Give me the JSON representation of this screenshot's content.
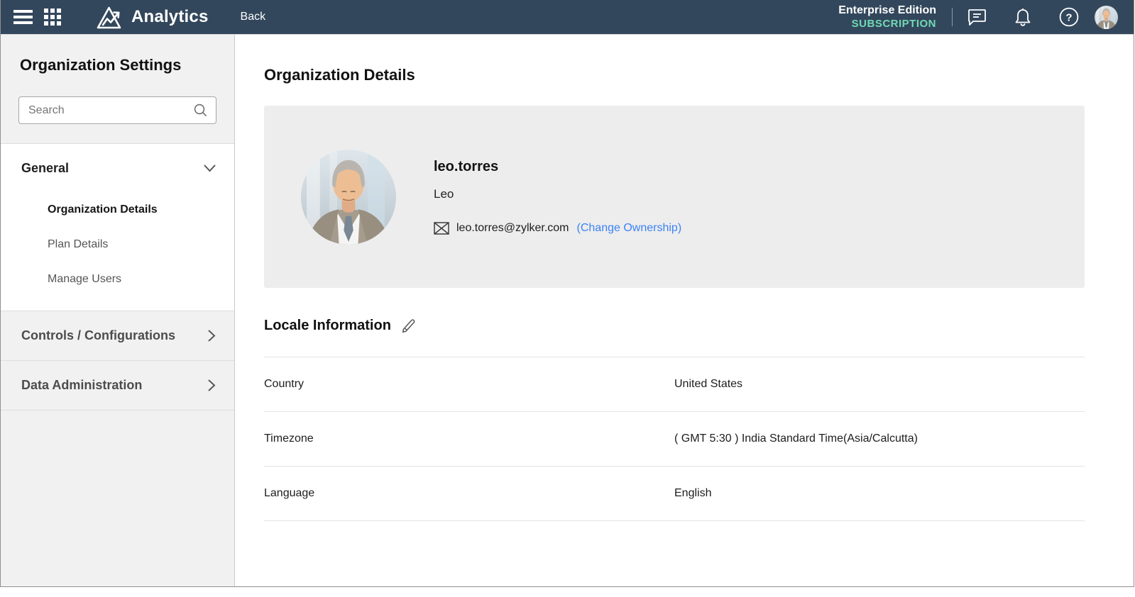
{
  "topbar": {
    "product_name": "Analytics",
    "back_label": "Back",
    "edition_name": "Enterprise Edition",
    "subscription_label": "SUBSCRIPTION",
    "help_glyph": "?"
  },
  "sidebar": {
    "title": "Organization Settings",
    "search": {
      "placeholder": "Search"
    },
    "general_group": {
      "label": "General",
      "items": [
        {
          "label": "Organization Details",
          "active": true
        },
        {
          "label": "Plan Details",
          "active": false
        },
        {
          "label": "Manage Users",
          "active": false
        }
      ]
    },
    "collapsed_groups": [
      {
        "label": "Controls / Configurations"
      },
      {
        "label": "Data Administration"
      }
    ]
  },
  "main": {
    "title": "Organization Details",
    "profile": {
      "username": "leo.torres",
      "display_name": "Leo",
      "email": "leo.torres@zylker.com",
      "change_ownership_label": "(Change Ownership)"
    },
    "locale": {
      "title": "Locale Information",
      "rows": [
        {
          "label": "Country",
          "value": "United States"
        },
        {
          "label": "Timezone",
          "value": "( GMT 5:30 ) India Standard Time(Asia/Calcutta)"
        },
        {
          "label": "Language",
          "value": "English"
        }
      ]
    }
  },
  "icons": {
    "hamburger": "menu",
    "apps_grid": "app-launcher",
    "logo": "analytics-mountain-arrow",
    "chat": "feedback-bubble",
    "bell": "notifications",
    "help": "question-circle",
    "search": "magnifier",
    "envelope": "email",
    "pencil": "edit"
  },
  "colors": {
    "topbar_bg": "#33475C",
    "subscription_teal": "#70D9B5",
    "link_blue": "#3C82F6",
    "sidebar_gray": "#f1f1f1",
    "card_gray": "#ededed"
  }
}
